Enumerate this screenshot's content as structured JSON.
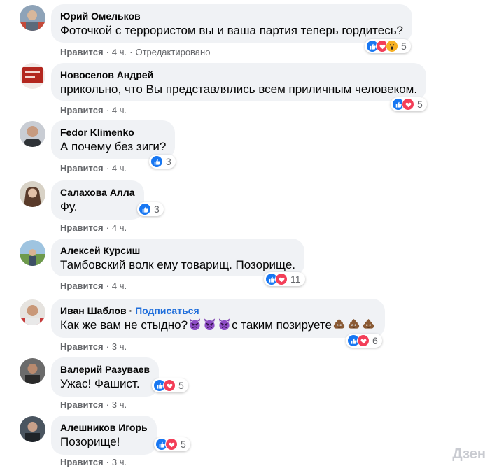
{
  "ui": {
    "like_label": "Нравится",
    "edited_label": "Отредактировано",
    "follow_label": "Подписаться"
  },
  "comments": [
    {
      "author": "Юрий Омельков",
      "text": "Фоточкой с террористом вы и ваша партия теперь гордитесь?",
      "time": "4 ч.",
      "edited": true,
      "reactions": [
        "like",
        "love",
        "wow"
      ],
      "count": "5"
    },
    {
      "author": "Новоселов Андрей",
      "text": "прикольно, что Вы представлялись всем приличным человеком.",
      "time": "4 ч.",
      "reactions": [
        "like",
        "love"
      ],
      "count": "5"
    },
    {
      "author": "Fedor Klimenko",
      "text": "А почему без зиги?",
      "time": "4 ч.",
      "reactions": [
        "like"
      ],
      "count": "3"
    },
    {
      "author": "Салахова Алла",
      "text": "Фу.",
      "time": "4 ч.",
      "reactions": [
        "like"
      ],
      "count": "3"
    },
    {
      "author": "Алексей Курсиш",
      "text": "Тамбовский волк ему товарищ. Позорище.",
      "time": "4 ч.",
      "reactions": [
        "like",
        "love"
      ],
      "count": "11"
    },
    {
      "author": "Иван Шаблов",
      "text_a": "Как же вам не стыдно?",
      "text_b": "с таким позируете",
      "emoji_a": [
        "angry-devil",
        "angry-devil",
        "angry-devil"
      ],
      "emoji_b": [
        "poop",
        "poop",
        "poop"
      ],
      "time": "3 ч.",
      "follow": true,
      "reactions": [
        "like",
        "love"
      ],
      "count": "6"
    },
    {
      "author": "Валерий Разуваев",
      "text": "Ужас! Фашист.",
      "time": "3 ч.",
      "reactions": [
        "like",
        "love"
      ],
      "count": "5"
    },
    {
      "author": "Алешников Игорь",
      "text": "Позорище!",
      "time": "3 ч.",
      "reactions": [
        "like",
        "love"
      ],
      "count": "5"
    }
  ],
  "watermark": "Дзен",
  "colors": {
    "bubble": "#f0f2f5",
    "meta": "#65676b",
    "link": "#216fdb",
    "like": "#1877f2",
    "love": "#f33e58",
    "wow": "#f7b125"
  }
}
